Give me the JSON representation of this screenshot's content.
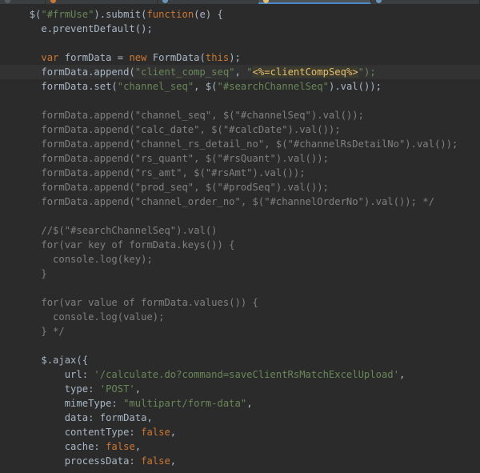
{
  "tabbar": {
    "tabs": [
      {
        "color": "#5a5d5f",
        "icon": "js-file-icon",
        "width": 56,
        "active": false
      },
      {
        "color": "#cc7832",
        "icon": "js-file-icon",
        "width": 140,
        "active": false
      },
      {
        "color": "#6897bb",
        "icon": "html-file-icon",
        "width": 126,
        "active": false
      },
      {
        "color": "#e8bf6a",
        "icon": "jsp-file-icon",
        "width": 142,
        "active": true
      },
      {
        "color": "#6897bb",
        "icon": "js-file-icon",
        "width": 136,
        "active": false
      }
    ]
  },
  "editor": {
    "current_line": 4,
    "lines": [
      {
        "indent": "  ",
        "tokens": [
          {
            "t": "$(",
            "c": "default"
          },
          {
            "t": "\"#frmUse\"",
            "c": "str"
          },
          {
            "t": ").submit(",
            "c": "default"
          },
          {
            "t": "function",
            "c": "kw"
          },
          {
            "t": "(e) {",
            "c": "default"
          }
        ]
      },
      {
        "indent": "    ",
        "tokens": [
          {
            "t": "e.preventDefault();",
            "c": "default"
          }
        ]
      },
      {
        "indent": "",
        "tokens": []
      },
      {
        "indent": "    ",
        "tokens": [
          {
            "t": "var ",
            "c": "kw"
          },
          {
            "t": "formData = ",
            "c": "default"
          },
          {
            "t": "new ",
            "c": "kw"
          },
          {
            "t": "FormData(",
            "c": "default"
          },
          {
            "t": "this",
            "c": "kw"
          },
          {
            "t": ");",
            "c": "default"
          }
        ]
      },
      {
        "indent": "    ",
        "tokens": [
          {
            "t": "formData.append(",
            "c": "default"
          },
          {
            "t": "\"client_comp_seq\"",
            "c": "str"
          },
          {
            "t": ", ",
            "c": "default"
          },
          {
            "t": "\"",
            "c": "str"
          },
          {
            "t": "<%=clientCompSeq%>",
            "c": "jsp"
          },
          {
            "t": "\");",
            "c": "str"
          }
        ]
      },
      {
        "indent": "    ",
        "tokens": [
          {
            "t": "formData.set(",
            "c": "default"
          },
          {
            "t": "\"channel_seq\"",
            "c": "str"
          },
          {
            "t": ", $(",
            "c": "default"
          },
          {
            "t": "\"#searchChannelSeq\"",
            "c": "str"
          },
          {
            "t": ").val());",
            "c": "default"
          }
        ]
      },
      {
        "indent": "",
        "tokens": []
      },
      {
        "indent": "    ",
        "tokens": [
          {
            "t": "formData.append(\"channel_seq\", $(\"#channelSeq\").val());",
            "c": "comment"
          }
        ]
      },
      {
        "indent": "    ",
        "tokens": [
          {
            "t": "formData.append(\"calc_date\", $(\"#calcDate\").val());",
            "c": "comment"
          }
        ]
      },
      {
        "indent": "    ",
        "tokens": [
          {
            "t": "formData.append(\"channel_rs_detail_no\", $(\"#channelRsDetailNo\").val());",
            "c": "comment"
          }
        ]
      },
      {
        "indent": "    ",
        "tokens": [
          {
            "t": "formData.append(\"rs_quant\", $(\"#rsQuant\").val());",
            "c": "comment"
          }
        ]
      },
      {
        "indent": "    ",
        "tokens": [
          {
            "t": "formData.append(\"rs_amt\", $(\"#rsAmt\").val());",
            "c": "comment"
          }
        ]
      },
      {
        "indent": "    ",
        "tokens": [
          {
            "t": "formData.append(\"prod_seq\", $(\"#prodSeq\").val());",
            "c": "comment"
          }
        ]
      },
      {
        "indent": "    ",
        "tokens": [
          {
            "t": "formData.append(\"channel_order_no\", $(\"#channelOrderNo\").val()); */",
            "c": "comment"
          }
        ]
      },
      {
        "indent": "",
        "tokens": []
      },
      {
        "indent": "    ",
        "tokens": [
          {
            "t": "//$(\"#searchChannelSeq\").val()",
            "c": "comment"
          }
        ]
      },
      {
        "indent": "    ",
        "tokens": [
          {
            "t": "for(var key of formData.keys()) {",
            "c": "comment"
          }
        ]
      },
      {
        "indent": "      ",
        "tokens": [
          {
            "t": "console.log(key);",
            "c": "comment"
          }
        ]
      },
      {
        "indent": "    ",
        "tokens": [
          {
            "t": "}",
            "c": "comment"
          }
        ]
      },
      {
        "indent": "",
        "tokens": []
      },
      {
        "indent": "    ",
        "tokens": [
          {
            "t": "for(var value of formData.values()) {",
            "c": "comment"
          }
        ]
      },
      {
        "indent": "      ",
        "tokens": [
          {
            "t": "console.log(value);",
            "c": "comment"
          }
        ]
      },
      {
        "indent": "    ",
        "tokens": [
          {
            "t": "} */",
            "c": "comment"
          }
        ]
      },
      {
        "indent": "",
        "tokens": []
      },
      {
        "indent": "    ",
        "tokens": [
          {
            "t": "$.ajax({",
            "c": "default"
          }
        ]
      },
      {
        "indent": "        ",
        "tokens": [
          {
            "t": "url: ",
            "c": "default"
          },
          {
            "t": "'/calculate.do?command=saveClientRsMatchExcelUpload'",
            "c": "str"
          },
          {
            "t": ",",
            "c": "default"
          }
        ]
      },
      {
        "indent": "        ",
        "tokens": [
          {
            "t": "type: ",
            "c": "default"
          },
          {
            "t": "'POST'",
            "c": "str"
          },
          {
            "t": ",",
            "c": "default"
          }
        ]
      },
      {
        "indent": "        ",
        "tokens": [
          {
            "t": "mimeType: ",
            "c": "default"
          },
          {
            "t": "\"multipart/form-data\"",
            "c": "str"
          },
          {
            "t": ",",
            "c": "default"
          }
        ]
      },
      {
        "indent": "        ",
        "tokens": [
          {
            "t": "data: formData,",
            "c": "default"
          }
        ]
      },
      {
        "indent": "        ",
        "tokens": [
          {
            "t": "contentType: ",
            "c": "default"
          },
          {
            "t": "false",
            "c": "kw"
          },
          {
            "t": ",",
            "c": "default"
          }
        ]
      },
      {
        "indent": "        ",
        "tokens": [
          {
            "t": "cache: ",
            "c": "default"
          },
          {
            "t": "false",
            "c": "kw"
          },
          {
            "t": ",",
            "c": "default"
          }
        ]
      },
      {
        "indent": "        ",
        "tokens": [
          {
            "t": "processData: ",
            "c": "default"
          },
          {
            "t": "false",
            "c": "kw"
          },
          {
            "t": ",",
            "c": "default"
          }
        ]
      }
    ]
  }
}
